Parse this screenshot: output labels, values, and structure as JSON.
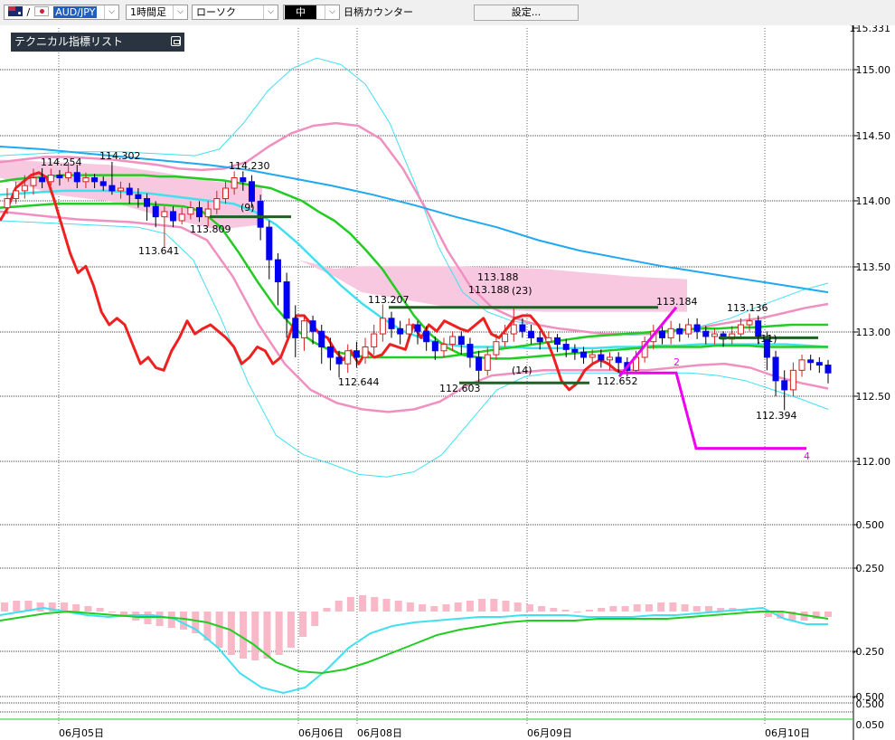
{
  "toolbar": {
    "pair": "AUD/JPY",
    "timeframe": "1時間足",
    "chart_type": "ローソク",
    "size": "中",
    "counter_label": "日柄カウンター",
    "settings_label": "設定..."
  },
  "indicator_list_label": "テクニカル指標リスト",
  "colors": {
    "background": "#ffffff",
    "bull_candle": "#ffffff",
    "bear_candle": "#0000ee",
    "red_line": "#ee2020",
    "green_ma": "#22cc22",
    "pink_band": "#f090c0",
    "cyan_band": "#40e0f0",
    "blue_ma": "#20a8f0",
    "cloud": "#f8c8e0",
    "magenta": "#ee00ee",
    "dark_green": "#206020"
  },
  "chart_data": {
    "type": "line",
    "price_axis": {
      "ticks": [
        "115.331",
        "115.00",
        "114.50",
        "114.00",
        "113.50",
        "113.00",
        "112.50",
        "112.00"
      ],
      "ylim": [
        111.5,
        115.331
      ]
    },
    "x_labels": [
      "06月05日",
      "06月06日",
      "06月08日",
      "06月09日",
      "06月10日"
    ],
    "annotations": [
      {
        "text": "114.254",
        "price": 114.254
      },
      {
        "text": "114.302",
        "price": 114.302
      },
      {
        "text": "114.230",
        "price": 114.23
      },
      {
        "text": "113.641",
        "price": 113.641
      },
      {
        "text": "113.809",
        "price": 113.809
      },
      {
        "text": "(9)",
        "price": 113.88
      },
      {
        "text": "113.207",
        "price": 113.207
      },
      {
        "text": "113.188",
        "price": 113.188
      },
      {
        "text": "113.188",
        "price": 113.188
      },
      {
        "text": "(23)",
        "price": 113.188
      },
      {
        "text": "113.184",
        "price": 113.184
      },
      {
        "text": "113.136",
        "price": 113.136
      },
      {
        "text": "(11)",
        "price": 112.95
      },
      {
        "text": "112.644",
        "price": 112.644
      },
      {
        "text": "112.603",
        "price": 112.603
      },
      {
        "text": "(14)",
        "price": 112.67
      },
      {
        "text": "112.652",
        "price": 112.652
      },
      {
        "text": "112.394",
        "price": 112.394
      }
    ],
    "wave_labels": [
      "2",
      "4"
    ],
    "candles": [
      [
        113.95,
        114.02,
        114.1,
        113.9
      ],
      [
        114.02,
        114.08,
        114.15,
        113.98
      ],
      [
        114.08,
        114.12,
        114.2,
        114.02
      ],
      [
        114.12,
        114.18,
        114.25,
        114.05
      ],
      [
        114.18,
        114.15,
        114.254,
        114.1
      ],
      [
        114.15,
        114.2,
        114.25,
        114.12
      ],
      [
        114.2,
        114.18,
        114.24,
        114.12
      ],
      [
        114.18,
        114.22,
        114.3,
        114.15
      ],
      [
        114.22,
        114.15,
        114.28,
        114.1
      ],
      [
        114.15,
        114.18,
        114.22,
        114.1
      ],
      [
        114.18,
        114.15,
        114.21,
        114.1
      ],
      [
        114.15,
        114.12,
        114.19,
        114.08
      ],
      [
        114.12,
        114.08,
        114.302,
        114.05
      ],
      [
        114.08,
        114.1,
        114.15,
        114.02
      ],
      [
        114.1,
        114.05,
        114.14,
        113.98
      ],
      [
        114.05,
        114.02,
        114.1,
        113.95
      ],
      [
        114.02,
        113.96,
        114.06,
        113.85
      ],
      [
        113.96,
        113.88,
        114.0,
        113.8
      ],
      [
        113.88,
        113.92,
        113.96,
        113.641
      ],
      [
        113.92,
        113.85,
        113.96,
        113.8
      ],
      [
        113.85,
        113.9,
        113.95,
        113.82
      ],
      [
        113.9,
        113.95,
        114.0,
        113.86
      ],
      [
        113.95,
        113.88,
        114.0,
        113.84
      ],
      [
        113.88,
        113.94,
        114.0,
        113.809
      ],
      [
        113.94,
        114.02,
        114.08,
        113.9
      ],
      [
        114.02,
        114.1,
        114.15,
        113.98
      ],
      [
        114.1,
        114.18,
        114.23,
        114.05
      ],
      [
        114.18,
        114.15,
        114.23,
        114.08
      ],
      [
        114.15,
        114.0,
        114.2,
        113.95
      ],
      [
        114.0,
        113.8,
        114.05,
        113.7
      ],
      [
        113.8,
        113.55,
        113.85,
        113.4
      ],
      [
        113.55,
        113.38,
        113.6,
        113.2
      ],
      [
        113.38,
        113.1,
        113.45,
        112.95
      ],
      [
        113.1,
        112.95,
        113.2,
        112.8
      ],
      [
        112.95,
        113.08,
        113.12,
        112.85
      ],
      [
        113.08,
        113.0,
        113.12,
        112.9
      ],
      [
        113.0,
        112.88,
        113.05,
        112.75
      ],
      [
        112.88,
        112.8,
        112.95,
        112.7
      ],
      [
        112.8,
        112.75,
        112.85,
        112.644
      ],
      [
        112.75,
        112.85,
        112.9,
        112.68
      ],
      [
        112.85,
        112.8,
        112.92,
        112.72
      ],
      [
        112.8,
        112.88,
        112.95,
        112.75
      ],
      [
        112.88,
        112.98,
        113.05,
        112.82
      ],
      [
        112.98,
        113.1,
        113.207,
        112.92
      ],
      [
        113.1,
        113.02,
        113.15,
        112.95
      ],
      [
        113.02,
        112.98,
        113.08,
        112.9
      ],
      [
        112.98,
        113.05,
        113.1,
        112.92
      ],
      [
        113.05,
        113.0,
        113.08,
        112.9
      ],
      [
        113.0,
        112.92,
        113.04,
        112.85
      ],
      [
        112.92,
        112.85,
        112.96,
        112.78
      ],
      [
        112.85,
        112.9,
        112.95,
        112.8
      ],
      [
        112.9,
        112.96,
        113.0,
        112.85
      ],
      [
        112.96,
        112.9,
        113.0,
        112.82
      ],
      [
        112.9,
        112.8,
        112.95,
        112.72
      ],
      [
        112.8,
        112.7,
        112.85,
        112.603
      ],
      [
        112.7,
        112.82,
        112.88,
        112.66
      ],
      [
        112.82,
        112.92,
        112.98,
        112.78
      ],
      [
        112.92,
        112.98,
        113.05,
        112.88
      ],
      [
        112.98,
        113.05,
        113.188,
        112.92
      ],
      [
        113.05,
        113.0,
        113.1,
        112.95
      ],
      [
        113.0,
        112.95,
        113.05,
        112.9
      ],
      [
        112.95,
        112.92,
        113.0,
        112.86
      ],
      [
        112.92,
        112.95,
        113.0,
        112.88
      ],
      [
        112.95,
        112.9,
        112.98,
        112.84
      ],
      [
        112.9,
        112.86,
        112.94,
        112.8
      ],
      [
        112.86,
        112.84,
        112.9,
        112.78
      ],
      [
        112.84,
        112.8,
        112.88,
        112.75
      ],
      [
        112.8,
        112.82,
        112.86,
        112.74
      ],
      [
        112.82,
        112.78,
        112.86,
        112.72
      ],
      [
        112.78,
        112.8,
        112.84,
        112.7
      ],
      [
        112.8,
        112.76,
        112.84,
        112.68
      ],
      [
        112.76,
        112.7,
        112.8,
        112.652
      ],
      [
        112.7,
        112.8,
        112.85,
        112.68
      ],
      [
        112.8,
        112.92,
        112.96,
        112.76
      ],
      [
        112.92,
        113.0,
        113.05,
        112.86
      ],
      [
        113.0,
        112.95,
        113.06,
        112.9
      ],
      [
        112.95,
        113.02,
        113.08,
        112.9
      ],
      [
        113.02,
        112.98,
        113.06,
        112.92
      ],
      [
        112.98,
        113.05,
        113.1,
        112.95
      ],
      [
        113.05,
        113.0,
        113.1,
        112.94
      ],
      [
        113.0,
        112.96,
        113.04,
        112.9
      ],
      [
        112.96,
        112.98,
        113.02,
        112.9
      ],
      [
        112.98,
        112.94,
        113.0,
        112.88
      ],
      [
        112.94,
        112.98,
        113.04,
        112.9
      ],
      [
        112.98,
        113.05,
        113.1,
        112.94
      ],
      [
        113.05,
        113.08,
        113.136,
        113.0
      ],
      [
        113.08,
        112.96,
        113.12,
        112.9
      ],
      [
        112.96,
        112.8,
        113.0,
        112.7
      ],
      [
        112.8,
        112.62,
        112.85,
        112.5
      ],
      [
        112.62,
        112.55,
        112.7,
        112.394
      ],
      [
        112.55,
        112.7,
        112.76,
        112.5
      ],
      [
        112.7,
        112.78,
        112.82,
        112.65
      ],
      [
        112.78,
        112.76,
        112.82,
        112.7
      ],
      [
        112.76,
        112.74,
        112.8,
        112.68
      ],
      [
        112.74,
        112.68,
        112.78,
        112.6
      ]
    ],
    "red_line": [
      113.85,
      113.95,
      114.1,
      114.15,
      114.2,
      114.22,
      114.18,
      114.0,
      113.8,
      113.6,
      113.45,
      113.5,
      113.35,
      113.15,
      113.05,
      113.1,
      113.05,
      112.9,
      112.75,
      112.8,
      112.72,
      112.7,
      112.85,
      112.95,
      113.08,
      112.98,
      113.02,
      113.05,
      113.0,
      112.95,
      112.88,
      112.75,
      112.8,
      112.88,
      112.85,
      112.75,
      112.8,
      112.95,
      113.12,
      113.12,
      113.05,
      112.98,
      112.95,
      112.85,
      112.78,
      112.85,
      112.75,
      112.85,
      112.8,
      112.82,
      112.9,
      112.88,
      112.86,
      113.05,
      112.95,
      113.05,
      113.0,
      113.08,
      113.05,
      113.02,
      113.0,
      113.05,
      113.1,
      112.98,
      112.95,
      113.02,
      113.1,
      113.12,
      113.12,
      113.05,
      112.95,
      112.8,
      112.62,
      112.55,
      112.6,
      112.7,
      112.75,
      112.78,
      112.75,
      112.7,
      112.68
    ],
    "green_long": [
      114.15,
      114.17,
      114.18,
      114.19,
      114.2,
      114.2,
      114.2,
      114.2,
      114.2,
      114.2,
      114.19,
      114.19,
      114.18,
      114.17,
      114.16,
      114.14,
      114.12,
      114.1,
      114.05,
      114.0,
      113.92,
      113.85,
      113.75,
      113.62,
      113.48,
      113.3,
      113.12,
      112.98,
      112.88,
      112.82,
      112.8,
      112.79,
      112.79,
      112.8,
      112.81,
      112.82,
      112.83,
      112.84,
      112.85,
      112.86,
      112.87,
      112.88,
      112.88,
      112.88,
      112.88,
      112.89,
      112.89,
      112.89,
      112.88,
      112.88,
      112.88,
      112.88,
      112.88
    ],
    "green_short": [
      113.95,
      113.96,
      113.97,
      113.98,
      113.98,
      113.98,
      113.98,
      113.98,
      113.98,
      113.97,
      113.96,
      113.92,
      113.8,
      113.6,
      113.38,
      113.18,
      113.02,
      112.92,
      112.85,
      112.82,
      112.8,
      112.8,
      112.8,
      112.8,
      112.8,
      112.82,
      112.84,
      112.86,
      112.88,
      112.9,
      112.92,
      112.94,
      112.96,
      112.97,
      112.98,
      112.99,
      113.0,
      113.01,
      113.02,
      113.02,
      113.03,
      113.03,
      113.04,
      113.05,
      113.05,
      113.05
    ],
    "blue_ma": [
      114.42,
      114.4,
      114.37,
      114.34,
      114.31,
      114.28,
      114.24,
      114.18,
      114.12,
      114.05,
      113.97,
      113.88,
      113.8,
      113.7,
      113.62,
      113.56,
      113.5,
      113.45,
      113.4,
      113.35,
      113.3
    ],
    "cyan_mid": [
      114.05,
      114.06,
      114.07,
      114.08,
      114.08,
      114.08,
      114.07,
      114.06,
      114.04,
      114.02,
      114.0,
      113.98,
      113.92,
      113.82,
      113.68,
      113.52,
      113.36,
      113.22,
      113.1,
      113.0,
      112.94,
      112.9,
      112.88,
      112.88,
      112.88,
      112.87,
      112.87,
      112.87,
      112.87,
      112.88,
      112.88,
      112.89,
      112.89,
      112.9,
      112.9,
      112.9,
      112.9,
      112.9,
      112.89,
      112.88
    ],
    "pink_upper": [
      114.3,
      114.32,
      114.34,
      114.34,
      114.33,
      114.32,
      114.3,
      114.28,
      114.25,
      114.24,
      114.25,
      114.3,
      114.42,
      114.52,
      114.58,
      114.6,
      114.58,
      114.48,
      114.25,
      113.95,
      113.62,
      113.35,
      113.18,
      113.1,
      113.05,
      113.02,
      113.0,
      112.98,
      112.98,
      112.98,
      113.0,
      113.02,
      113.05,
      113.08,
      113.1,
      113.14,
      113.18,
      113.21
    ],
    "pink_lower": [
      113.92,
      113.9,
      113.88,
      113.86,
      113.85,
      113.84,
      113.82,
      113.8,
      113.7,
      113.42,
      113.05,
      112.75,
      112.55,
      112.45,
      112.4,
      112.38,
      112.4,
      112.46,
      112.58,
      112.66,
      112.68,
      112.7,
      112.7,
      112.7,
      112.7,
      112.7,
      112.72,
      112.74,
      112.75,
      112.72,
      112.65,
      112.6,
      112.56
    ],
    "cyan_upper": [
      114.35,
      114.36,
      114.37,
      114.38,
      114.38,
      114.38,
      114.37,
      114.36,
      114.35,
      114.4,
      114.6,
      114.85,
      115.02,
      115.1,
      115.05,
      114.9,
      114.6,
      114.15,
      113.65,
      113.3,
      113.15,
      113.08,
      113.05,
      113.02,
      113.0,
      112.98,
      112.97,
      112.98,
      113.0,
      113.05,
      113.1,
      113.18,
      113.25,
      113.32,
      113.37
    ],
    "cyan_lower": [
      113.85,
      113.84,
      113.83,
      113.82,
      113.81,
      113.8,
      113.75,
      113.55,
      113.1,
      112.6,
      112.2,
      112.05,
      111.98,
      111.9,
      111.88,
      111.92,
      112.05,
      112.3,
      112.55,
      112.65,
      112.68,
      112.68,
      112.68,
      112.68,
      112.68,
      112.68,
      112.66,
      112.62,
      112.55,
      112.48,
      112.4
    ],
    "macd": {
      "ticks": [
        "0.500",
        "0.250",
        "-0.250",
        "-0.500"
      ],
      "ylim": [
        -0.55,
        0.55
      ],
      "bars": [
        0.05,
        0.06,
        0.06,
        0.05,
        0.05,
        0.05,
        0.04,
        0.03,
        0.02,
        0.0,
        -0.03,
        -0.05,
        -0.07,
        -0.08,
        -0.09,
        -0.1,
        -0.12,
        -0.16,
        -0.2,
        -0.24,
        -0.26,
        -0.27,
        -0.26,
        -0.24,
        -0.2,
        -0.14,
        -0.08,
        0.02,
        0.06,
        0.08,
        0.09,
        0.08,
        0.07,
        0.06,
        0.05,
        0.04,
        0.03,
        0.04,
        0.05,
        0.06,
        0.07,
        0.07,
        0.06,
        0.05,
        0.04,
        0.03,
        0.02,
        0.01,
        0.0,
        0.01,
        0.02,
        0.03,
        0.03,
        0.04,
        0.04,
        0.05,
        0.05,
        0.04,
        0.03,
        0.03,
        0.02,
        0.02,
        0.01,
        -0.01,
        -0.03,
        -0.04,
        -0.05,
        -0.05,
        -0.04,
        -0.03
      ],
      "macd_line": [
        -0.02,
        0.0,
        0.02,
        0.0,
        -0.02,
        -0.03,
        -0.02,
        -0.02,
        -0.04,
        -0.1,
        -0.2,
        -0.34,
        -0.42,
        -0.45,
        -0.42,
        -0.32,
        -0.2,
        -0.12,
        -0.08,
        -0.06,
        -0.05,
        -0.04,
        -0.03,
        -0.03,
        -0.02,
        -0.02,
        -0.02,
        -0.03,
        -0.03,
        -0.03,
        -0.02,
        -0.02,
        -0.01,
        0.0,
        0.01,
        0.02,
        -0.04,
        -0.07,
        -0.07
      ],
      "signal_line": [
        -0.05,
        -0.03,
        -0.01,
        0.0,
        -0.01,
        -0.02,
        -0.03,
        -0.03,
        -0.04,
        -0.06,
        -0.1,
        -0.18,
        -0.28,
        -0.33,
        -0.34,
        -0.32,
        -0.28,
        -0.23,
        -0.18,
        -0.13,
        -0.1,
        -0.08,
        -0.06,
        -0.05,
        -0.05,
        -0.05,
        -0.04,
        -0.04,
        -0.04,
        -0.04,
        -0.03,
        -0.02,
        -0.01,
        0.0,
        0.0,
        -0.02,
        -0.04
      ]
    },
    "bottom_pane": {
      "ticks": [
        "0.500",
        "0.050"
      ]
    }
  }
}
